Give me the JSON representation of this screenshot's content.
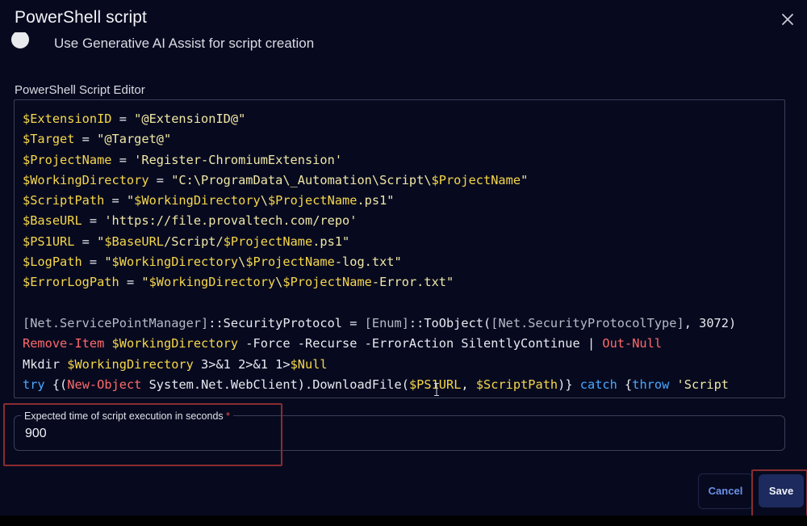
{
  "dialog": {
    "title": "PowerShell script",
    "close_icon": "close-icon"
  },
  "ai_toggle": {
    "label": "Use Generative AI Assist for script creation"
  },
  "editor": {
    "label": "PowerShell Script Editor",
    "lines": [
      [
        {
          "t": "$ExtensionID",
          "c": "v"
        },
        {
          "t": " = ",
          "c": "w"
        },
        {
          "t": "\"@ExtensionID@\"",
          "c": "s"
        }
      ],
      [
        {
          "t": "$Target",
          "c": "v"
        },
        {
          "t": " = ",
          "c": "w"
        },
        {
          "t": "\"@Target@\"",
          "c": "s"
        }
      ],
      [
        {
          "t": "$ProjectName",
          "c": "v"
        },
        {
          "t": " = ",
          "c": "w"
        },
        {
          "t": "'Register-ChromiumExtension'",
          "c": "s"
        }
      ],
      [
        {
          "t": "$WorkingDirectory",
          "c": "v"
        },
        {
          "t": " = ",
          "c": "w"
        },
        {
          "t": "\"C:\\ProgramData\\_Automation\\Script\\",
          "c": "s"
        },
        {
          "t": "$ProjectName",
          "c": "v"
        },
        {
          "t": "\"",
          "c": "s"
        }
      ],
      [
        {
          "t": "$ScriptPath",
          "c": "v"
        },
        {
          "t": " = ",
          "c": "w"
        },
        {
          "t": "\"",
          "c": "s"
        },
        {
          "t": "$WorkingDirectory",
          "c": "v"
        },
        {
          "t": "\\",
          "c": "s"
        },
        {
          "t": "$ProjectName",
          "c": "v"
        },
        {
          "t": ".ps1\"",
          "c": "s"
        }
      ],
      [
        {
          "t": "$BaseURL",
          "c": "v"
        },
        {
          "t": " = ",
          "c": "w"
        },
        {
          "t": "'https://file.provaltech.com/repo'",
          "c": "s"
        }
      ],
      [
        {
          "t": "$PS1URL",
          "c": "v"
        },
        {
          "t": " = ",
          "c": "w"
        },
        {
          "t": "\"",
          "c": "s"
        },
        {
          "t": "$BaseURL",
          "c": "v"
        },
        {
          "t": "/Script/",
          "c": "s"
        },
        {
          "t": "$ProjectName",
          "c": "v"
        },
        {
          "t": ".ps1\"",
          "c": "s"
        }
      ],
      [
        {
          "t": "$LogPath",
          "c": "v"
        },
        {
          "t": " = ",
          "c": "w"
        },
        {
          "t": "\"",
          "c": "s"
        },
        {
          "t": "$WorkingDirectory",
          "c": "v"
        },
        {
          "t": "\\",
          "c": "s"
        },
        {
          "t": "$ProjectName",
          "c": "v"
        },
        {
          "t": "-log.txt\"",
          "c": "s"
        }
      ],
      [
        {
          "t": "$ErrorLogPath",
          "c": "v"
        },
        {
          "t": " = ",
          "c": "w"
        },
        {
          "t": "\"",
          "c": "s"
        },
        {
          "t": "$WorkingDirectory",
          "c": "v"
        },
        {
          "t": "\\",
          "c": "s"
        },
        {
          "t": "$ProjectName",
          "c": "v"
        },
        {
          "t": "-Error.txt\"",
          "c": "s"
        }
      ],
      [],
      [
        {
          "t": "[Net.ServicePointManager]",
          "c": "g"
        },
        {
          "t": "::SecurityProtocol = ",
          "c": "w"
        },
        {
          "t": "[Enum]",
          "c": "g"
        },
        {
          "t": "::ToObject(",
          "c": "w"
        },
        {
          "t": "[Net.SecurityProtocolType]",
          "c": "g"
        },
        {
          "t": ", 3072)",
          "c": "w"
        }
      ],
      [
        {
          "t": "Remove-Item",
          "c": "c"
        },
        {
          "t": " ",
          "c": "w"
        },
        {
          "t": "$WorkingDirectory",
          "c": "v"
        },
        {
          "t": " -Force -Recurse -ErrorAction SilentlyContinue | ",
          "c": "w"
        },
        {
          "t": "Out-Null",
          "c": "c"
        }
      ],
      [
        {
          "t": "Mkdir ",
          "c": "w"
        },
        {
          "t": "$WorkingDirectory",
          "c": "v"
        },
        {
          "t": " 3>&1 2>&1 1>",
          "c": "w"
        },
        {
          "t": "$Null",
          "c": "v"
        }
      ],
      [
        {
          "t": "try",
          "c": "k"
        },
        {
          "t": " {(",
          "c": "w"
        },
        {
          "t": "New-Object",
          "c": "c"
        },
        {
          "t": " System.Net.WebClient).DownloadFile(",
          "c": "w"
        },
        {
          "t": "$PS1URL",
          "c": "v"
        },
        {
          "t": ", ",
          "c": "w"
        },
        {
          "t": "$ScriptPath",
          "c": "v"
        },
        {
          "t": ")} ",
          "c": "w"
        },
        {
          "t": "catch",
          "c": "k"
        },
        {
          "t": " {",
          "c": "w"
        },
        {
          "t": "throw",
          "c": "k"
        },
        {
          "t": " ",
          "c": "w"
        },
        {
          "t": "'Script",
          "c": "s"
        }
      ]
    ]
  },
  "execution_time": {
    "label": "Expected time of script execution in seconds",
    "required_mark": "*",
    "value": "900"
  },
  "actions": {
    "cancel_label": "Cancel",
    "save_label": "Save"
  },
  "colors": {
    "background": "#070a1f",
    "variable": "#f6d74a",
    "string": "#f0e7a6",
    "keyword": "#4aa8ff",
    "cmdlet": "#ff6a6a",
    "type": "#b7bac6",
    "primary_button": "#1d2a5e",
    "highlight_box": "#8a2c30"
  }
}
